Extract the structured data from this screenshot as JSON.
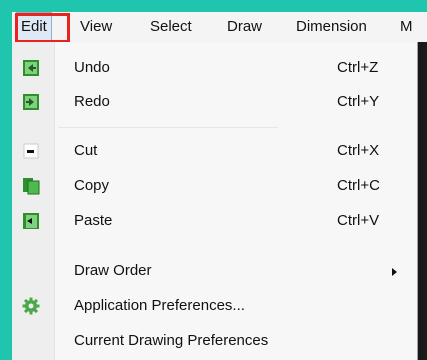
{
  "menubar": {
    "items": [
      {
        "label": "Edit"
      },
      {
        "label": "View"
      },
      {
        "label": "Select"
      },
      {
        "label": "Draw"
      },
      {
        "label": "Dimension"
      },
      {
        "label": "M"
      }
    ]
  },
  "menu": {
    "items": [
      {
        "label": "Undo",
        "shortcut": "Ctrl+Z",
        "icon": "undo-icon"
      },
      {
        "label": "Redo",
        "shortcut": "Ctrl+Y",
        "icon": "redo-icon"
      },
      {
        "label": "Cut",
        "shortcut": "Ctrl+X",
        "icon": "cut-icon"
      },
      {
        "label": "Copy",
        "shortcut": "Ctrl+C",
        "icon": "copy-icon"
      },
      {
        "label": "Paste",
        "shortcut": "Ctrl+V",
        "icon": "paste-icon"
      },
      {
        "label": "Draw Order",
        "icon": "submenu-arrow-icon"
      },
      {
        "label": "Application Preferences...",
        "icon": "gear-icon"
      },
      {
        "label": "Current Drawing Preferences"
      }
    ]
  },
  "colors": {
    "background": "#1fc5ac",
    "highlight_border": "#e8241f",
    "icon_green": "#3aa53a"
  }
}
